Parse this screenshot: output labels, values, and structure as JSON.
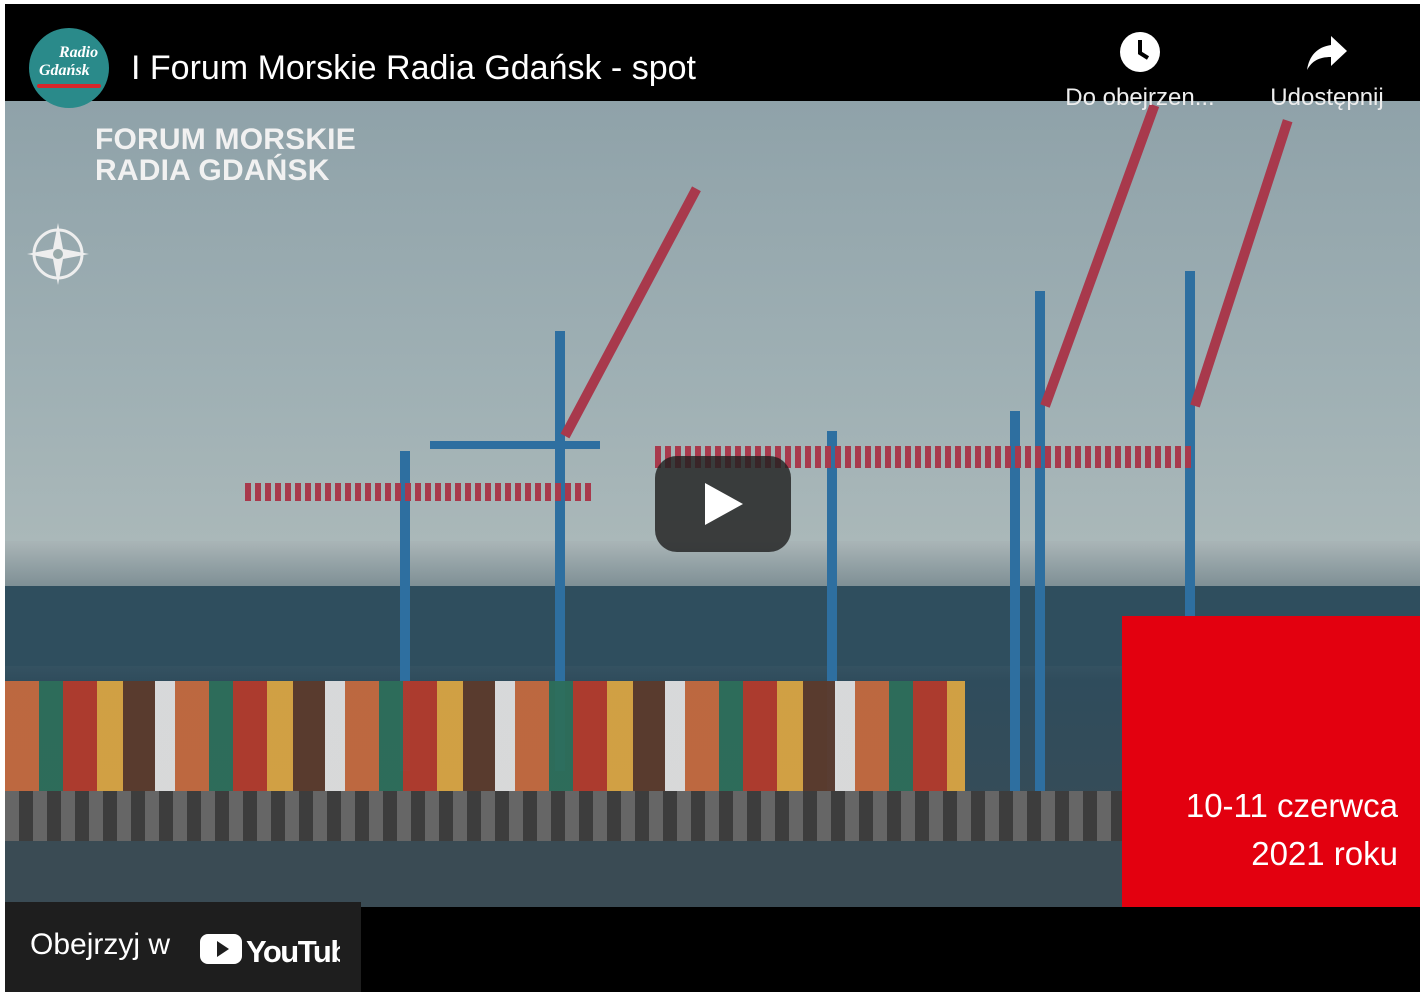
{
  "video": {
    "title": "I Forum Morskie Radia Gdańsk - spot",
    "channel_logo_text": [
      "Radio",
      "Gdańsk"
    ]
  },
  "actions": {
    "watch_later": "Do obejrzen...",
    "share": "Udostępnij"
  },
  "overlay": {
    "forum_logo_lines": [
      "FORUM MORSKIE",
      "RADIA GDAŃSK"
    ],
    "date_lines": [
      "10-11 czerwca",
      "2021 roku"
    ]
  },
  "footer": {
    "watch_on": "Obejrzyj w",
    "platform": "YouTube"
  },
  "colors": {
    "accent_red": "#e3000f",
    "channel_teal": "#2a8a8a"
  },
  "icons": [
    "close-icon",
    "clock-icon",
    "share-arrow-icon",
    "play-icon",
    "youtube-logo-icon",
    "compass-rose-icon"
  ]
}
